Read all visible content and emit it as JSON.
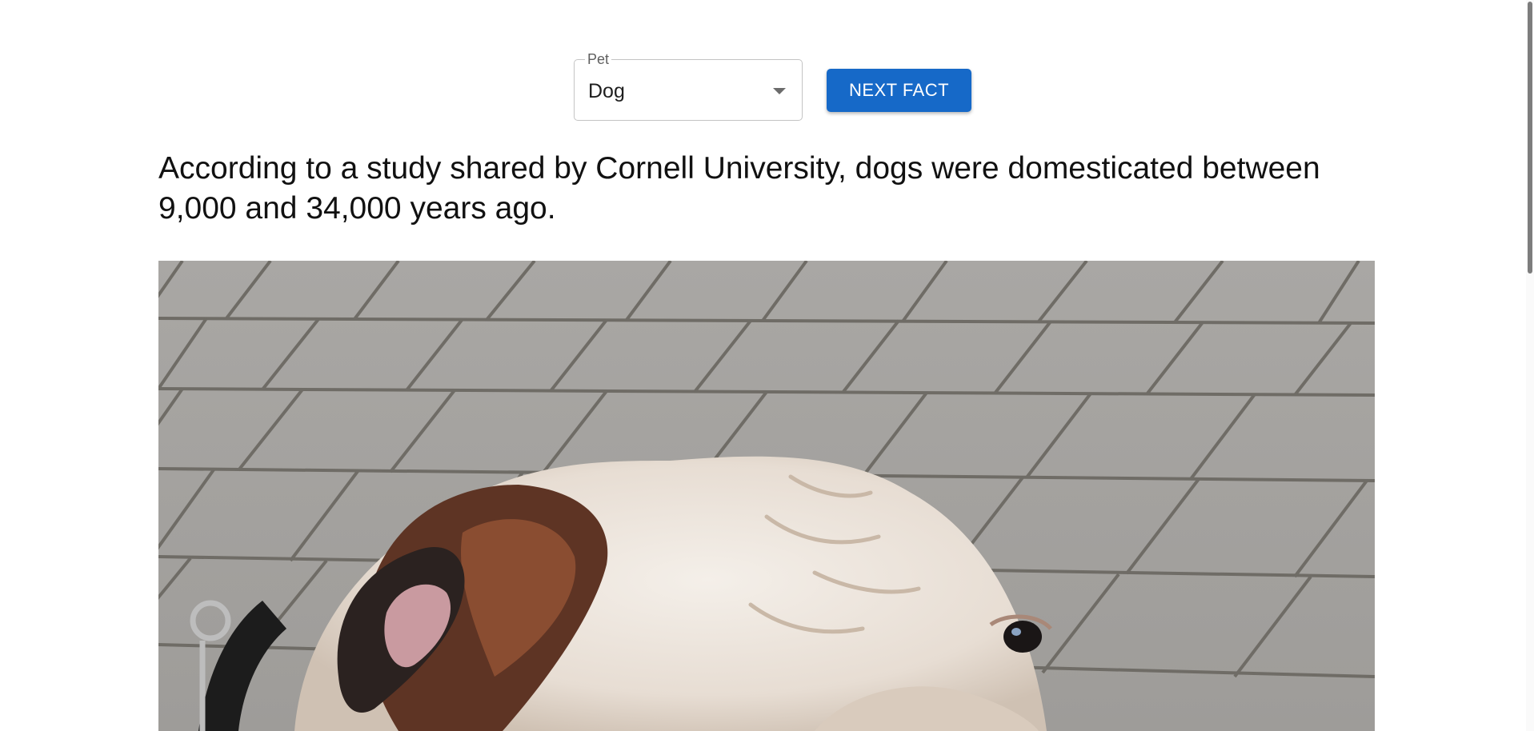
{
  "pet_select": {
    "label": "Pet",
    "value": "Dog"
  },
  "next_button": {
    "label": "NEXT FACT"
  },
  "fact": {
    "text": "According to a study shared by Cornell University, dogs were domesticated between 9,000 and 34,000 years ago."
  },
  "colors": {
    "accent": "#1669c8",
    "text": "#111111"
  },
  "icons": {
    "select_arrow": "chevron-down-icon"
  }
}
